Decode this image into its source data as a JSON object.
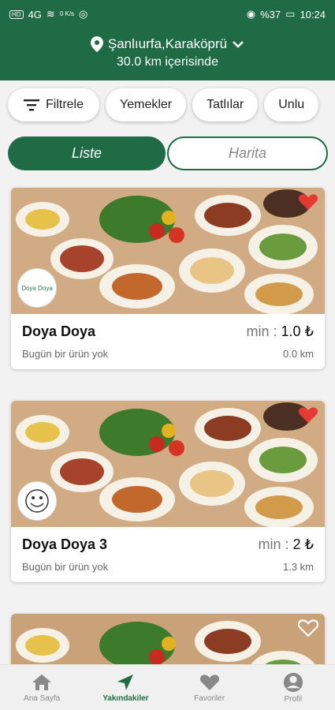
{
  "status_bar": {
    "left": [
      "HD",
      "4G",
      "≋",
      "0 K/s",
      "◎"
    ],
    "battery": "%37",
    "time": "10:24"
  },
  "location": {
    "city": "Şanlıurfa,Karaköprü",
    "radius": "30.0 km içerisinde"
  },
  "chips": [
    {
      "label": "Filtrele"
    },
    {
      "label": "Yemekler"
    },
    {
      "label": "Tatlılar"
    },
    {
      "label": "Unlu"
    }
  ],
  "view_toggle": {
    "active": "Liste",
    "inactive": "Harita"
  },
  "cards": [
    {
      "name": "Doya Doya",
      "min_label": "min :",
      "min_value": "1.0 ₺",
      "status": "Bugün bir ürün yok",
      "distance": "0.0 km",
      "favorite": true,
      "logo_text": "Doya Doya"
    },
    {
      "name": "Doya Doya 3",
      "min_label": "min :",
      "min_value": "2 ₺",
      "status": "Bugün bir ürün yok",
      "distance": "1.3 km",
      "favorite": true,
      "logo_text": ""
    },
    {
      "name": "",
      "favorite": false
    }
  ],
  "nav": [
    {
      "label": "Ana Sayfa",
      "icon": "home-icon"
    },
    {
      "label": "Yakındakiler",
      "icon": "navigation-icon",
      "active": true
    },
    {
      "label": "Favoriler",
      "icon": "heart-icon"
    },
    {
      "label": "Profil",
      "icon": "profile-icon"
    }
  ],
  "colors": {
    "primary": "#1f6b46",
    "heart": "#e53935"
  }
}
